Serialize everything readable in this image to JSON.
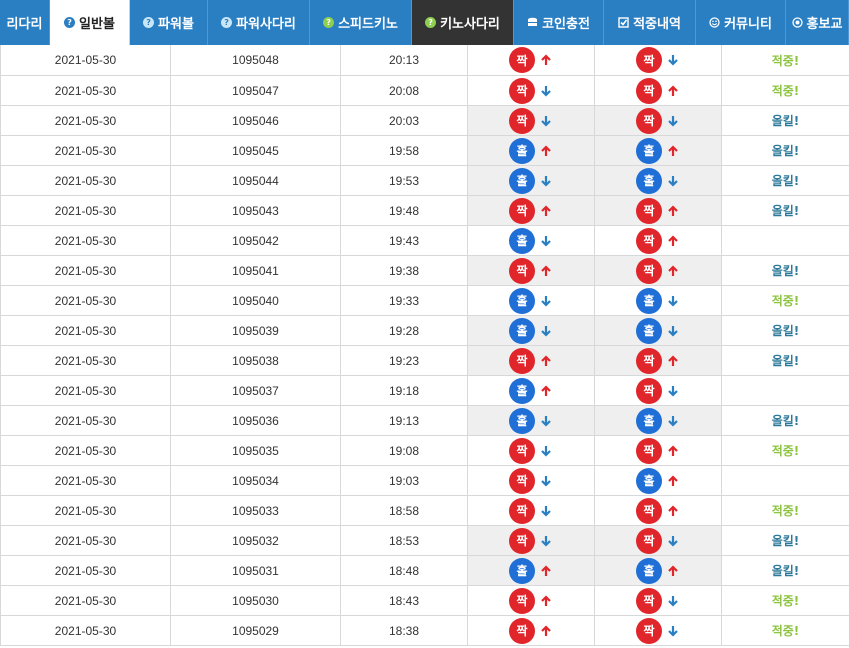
{
  "nav": {
    "tabs": [
      {
        "label": "리다리",
        "icon": "none",
        "state": "normal",
        "width": 50
      },
      {
        "label": "일반볼",
        "icon": "question-icon",
        "state": "active",
        "width": 80
      },
      {
        "label": "파워볼",
        "icon": "question-icon",
        "state": "normal",
        "width": 78
      },
      {
        "label": "파워사다리",
        "icon": "question-icon",
        "state": "normal",
        "width": 102
      },
      {
        "label": "스피드키노",
        "icon": "question-green-icon",
        "state": "normal",
        "width": 102
      },
      {
        "label": "키노사다리",
        "icon": "question-green-icon",
        "state": "dark",
        "width": 102
      },
      {
        "label": "코인충전",
        "icon": "database-icon",
        "state": "normal",
        "width": 90
      },
      {
        "label": "적중내역",
        "icon": "check-square-icon",
        "state": "normal",
        "width": 92
      },
      {
        "label": "커뮤니티",
        "icon": "smile-icon",
        "state": "normal",
        "width": 90
      },
      {
        "label": "홍보교",
        "icon": "target-icon",
        "state": "normal",
        "width": 63
      }
    ]
  },
  "colors": {
    "nav_bg": "#2a7fc3",
    "odd": "#1f6fd6",
    "even": "#e0262b",
    "arrow_up": "#e0262b",
    "arrow_down": "#2a7fc3",
    "hit": "#8cc43f",
    "allkill": "#2f7a9a",
    "shade": "#efefef"
  },
  "labels": {
    "odd": "홀",
    "even": "짝"
  },
  "rows": [
    {
      "date": "2021-05-30",
      "round": "1095048",
      "time": "20:13",
      "pick1": {
        "v": "짝",
        "dir": "up"
      },
      "pick2": {
        "v": "짝",
        "dir": "down"
      },
      "result": "적중!",
      "rtype": "hit",
      "shade": false
    },
    {
      "date": "2021-05-30",
      "round": "1095047",
      "time": "20:08",
      "pick1": {
        "v": "짝",
        "dir": "down"
      },
      "pick2": {
        "v": "짝",
        "dir": "up"
      },
      "result": "적중!",
      "rtype": "hit",
      "shade": false
    },
    {
      "date": "2021-05-30",
      "round": "1095046",
      "time": "20:03",
      "pick1": {
        "v": "짝",
        "dir": "down"
      },
      "pick2": {
        "v": "짝",
        "dir": "down"
      },
      "result": "올킬!",
      "rtype": "allkill",
      "shade": true
    },
    {
      "date": "2021-05-30",
      "round": "1095045",
      "time": "19:58",
      "pick1": {
        "v": "홀",
        "dir": "up"
      },
      "pick2": {
        "v": "홀",
        "dir": "up"
      },
      "result": "올킬!",
      "rtype": "allkill",
      "shade": true
    },
    {
      "date": "2021-05-30",
      "round": "1095044",
      "time": "19:53",
      "pick1": {
        "v": "홀",
        "dir": "down"
      },
      "pick2": {
        "v": "홀",
        "dir": "down"
      },
      "result": "올킬!",
      "rtype": "allkill",
      "shade": true
    },
    {
      "date": "2021-05-30",
      "round": "1095043",
      "time": "19:48",
      "pick1": {
        "v": "짝",
        "dir": "up"
      },
      "pick2": {
        "v": "짝",
        "dir": "up"
      },
      "result": "올킬!",
      "rtype": "allkill",
      "shade": true
    },
    {
      "date": "2021-05-30",
      "round": "1095042",
      "time": "19:43",
      "pick1": {
        "v": "홀",
        "dir": "down"
      },
      "pick2": {
        "v": "짝",
        "dir": "up"
      },
      "result": "",
      "rtype": "none",
      "shade": false
    },
    {
      "date": "2021-05-30",
      "round": "1095041",
      "time": "19:38",
      "pick1": {
        "v": "짝",
        "dir": "up"
      },
      "pick2": {
        "v": "짝",
        "dir": "up"
      },
      "result": "올킬!",
      "rtype": "allkill",
      "shade": true
    },
    {
      "date": "2021-05-30",
      "round": "1095040",
      "time": "19:33",
      "pick1": {
        "v": "홀",
        "dir": "down"
      },
      "pick2": {
        "v": "홀",
        "dir": "down"
      },
      "result": "적중!",
      "rtype": "hit",
      "shade": false
    },
    {
      "date": "2021-05-30",
      "round": "1095039",
      "time": "19:28",
      "pick1": {
        "v": "홀",
        "dir": "down"
      },
      "pick2": {
        "v": "홀",
        "dir": "down"
      },
      "result": "올킬!",
      "rtype": "allkill",
      "shade": true
    },
    {
      "date": "2021-05-30",
      "round": "1095038",
      "time": "19:23",
      "pick1": {
        "v": "짝",
        "dir": "up"
      },
      "pick2": {
        "v": "짝",
        "dir": "up"
      },
      "result": "올킬!",
      "rtype": "allkill",
      "shade": true
    },
    {
      "date": "2021-05-30",
      "round": "1095037",
      "time": "19:18",
      "pick1": {
        "v": "홀",
        "dir": "up"
      },
      "pick2": {
        "v": "짝",
        "dir": "down"
      },
      "result": "",
      "rtype": "none",
      "shade": false
    },
    {
      "date": "2021-05-30",
      "round": "1095036",
      "time": "19:13",
      "pick1": {
        "v": "홀",
        "dir": "down"
      },
      "pick2": {
        "v": "홀",
        "dir": "down"
      },
      "result": "올킬!",
      "rtype": "allkill",
      "shade": true
    },
    {
      "date": "2021-05-30",
      "round": "1095035",
      "time": "19:08",
      "pick1": {
        "v": "짝",
        "dir": "down"
      },
      "pick2": {
        "v": "짝",
        "dir": "up"
      },
      "result": "적중!",
      "rtype": "hit",
      "shade": false
    },
    {
      "date": "2021-05-30",
      "round": "1095034",
      "time": "19:03",
      "pick1": {
        "v": "짝",
        "dir": "down"
      },
      "pick2": {
        "v": "홀",
        "dir": "up"
      },
      "result": "",
      "rtype": "none",
      "shade": false
    },
    {
      "date": "2021-05-30",
      "round": "1095033",
      "time": "18:58",
      "pick1": {
        "v": "짝",
        "dir": "down"
      },
      "pick2": {
        "v": "짝",
        "dir": "up"
      },
      "result": "적중!",
      "rtype": "hit",
      "shade": false
    },
    {
      "date": "2021-05-30",
      "round": "1095032",
      "time": "18:53",
      "pick1": {
        "v": "짝",
        "dir": "down"
      },
      "pick2": {
        "v": "짝",
        "dir": "down"
      },
      "result": "올킬!",
      "rtype": "allkill",
      "shade": true
    },
    {
      "date": "2021-05-30",
      "round": "1095031",
      "time": "18:48",
      "pick1": {
        "v": "홀",
        "dir": "up"
      },
      "pick2": {
        "v": "홀",
        "dir": "up"
      },
      "result": "올킬!",
      "rtype": "allkill",
      "shade": true
    },
    {
      "date": "2021-05-30",
      "round": "1095030",
      "time": "18:43",
      "pick1": {
        "v": "짝",
        "dir": "up"
      },
      "pick2": {
        "v": "짝",
        "dir": "down"
      },
      "result": "적중!",
      "rtype": "hit",
      "shade": false
    },
    {
      "date": "2021-05-30",
      "round": "1095029",
      "time": "18:38",
      "pick1": {
        "v": "짝",
        "dir": "up"
      },
      "pick2": {
        "v": "짝",
        "dir": "down"
      },
      "result": "적중!",
      "rtype": "hit",
      "shade": false
    }
  ]
}
